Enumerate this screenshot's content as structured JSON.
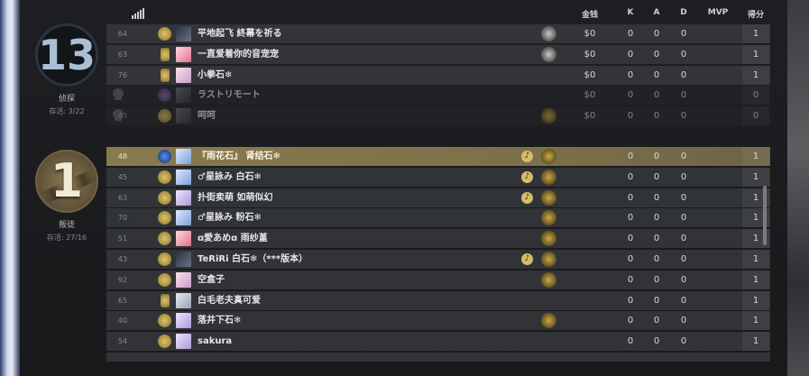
{
  "header": {
    "cols": {
      "money": "金钱",
      "k": "K",
      "a": "A",
      "d": "D",
      "mvp": "MVP",
      "score": "得分"
    },
    "signal_icon": "signal-bars-icon"
  },
  "ct_team": {
    "score": "13",
    "role": "侦探",
    "alive": "存活: 3/22",
    "players": [
      {
        "ping": "64",
        "name": "平地起飞 終幕を祈る",
        "money": "$0",
        "k": "0",
        "a": "0",
        "d": "0",
        "mvp": "",
        "score": "1",
        "dead": false
      },
      {
        "ping": "63",
        "name": "一直爱着你的音宠宠",
        "money": "$0",
        "k": "0",
        "a": "0",
        "d": "0",
        "mvp": "",
        "score": "1",
        "dead": false
      },
      {
        "ping": "76",
        "name": "小拳石❄",
        "money": "$0",
        "k": "0",
        "a": "0",
        "d": "0",
        "mvp": "",
        "score": "1",
        "dead": false
      },
      {
        "ping": "",
        "name": "ラストリモート",
        "money": "$0",
        "k": "0",
        "a": "0",
        "d": "0",
        "mvp": "",
        "score": "0",
        "dead": true
      },
      {
        "ping": "43",
        "name": "呵呵",
        "money": "$0",
        "k": "0",
        "a": "0",
        "d": "0",
        "mvp": "",
        "score": "0",
        "dead": true
      }
    ]
  },
  "t_team": {
    "score": "1",
    "role": "叛徒",
    "alive": "存活: 27/16",
    "players": [
      {
        "ping": "48",
        "name": "『雨花石』 肾结石❄",
        "k": "0",
        "a": "0",
        "d": "0",
        "mvp": "",
        "score": "1",
        "music": true
      },
      {
        "ping": "45",
        "name": "♂星詠み 白石❄",
        "k": "0",
        "a": "0",
        "d": "0",
        "mvp": "",
        "score": "1",
        "music": true
      },
      {
        "ping": "63",
        "name": "扑街卖萌 如萌似幻",
        "k": "0",
        "a": "0",
        "d": "0",
        "mvp": "",
        "score": "1",
        "music": true
      },
      {
        "ping": "70",
        "name": "♂星詠み 粉石❄",
        "k": "0",
        "a": "0",
        "d": "0",
        "mvp": "",
        "score": "1",
        "music": false
      },
      {
        "ping": "51",
        "name": "ɑ愛あめɑ 雨纱堇",
        "k": "0",
        "a": "0",
        "d": "0",
        "mvp": "",
        "score": "1",
        "music": false
      },
      {
        "ping": "43",
        "name": "TeRiRi 白石❄（***版本）",
        "k": "0",
        "a": "0",
        "d": "0",
        "mvp": "",
        "score": "1",
        "music": true
      },
      {
        "ping": "92",
        "name": "空盒子",
        "k": "0",
        "a": "0",
        "d": "0",
        "mvp": "",
        "score": "1",
        "music": false
      },
      {
        "ping": "65",
        "name": "白毛老夫真可爱",
        "k": "0",
        "a": "0",
        "d": "0",
        "mvp": "",
        "score": "1",
        "music": false
      },
      {
        "ping": "40",
        "name": "落井下石❄",
        "k": "0",
        "a": "0",
        "d": "0",
        "mvp": "",
        "score": "1",
        "music": false
      },
      {
        "ping": "54",
        "name": "sakura",
        "k": "0",
        "a": "0",
        "d": "0",
        "mvp": "",
        "score": "1",
        "music": false
      }
    ]
  }
}
